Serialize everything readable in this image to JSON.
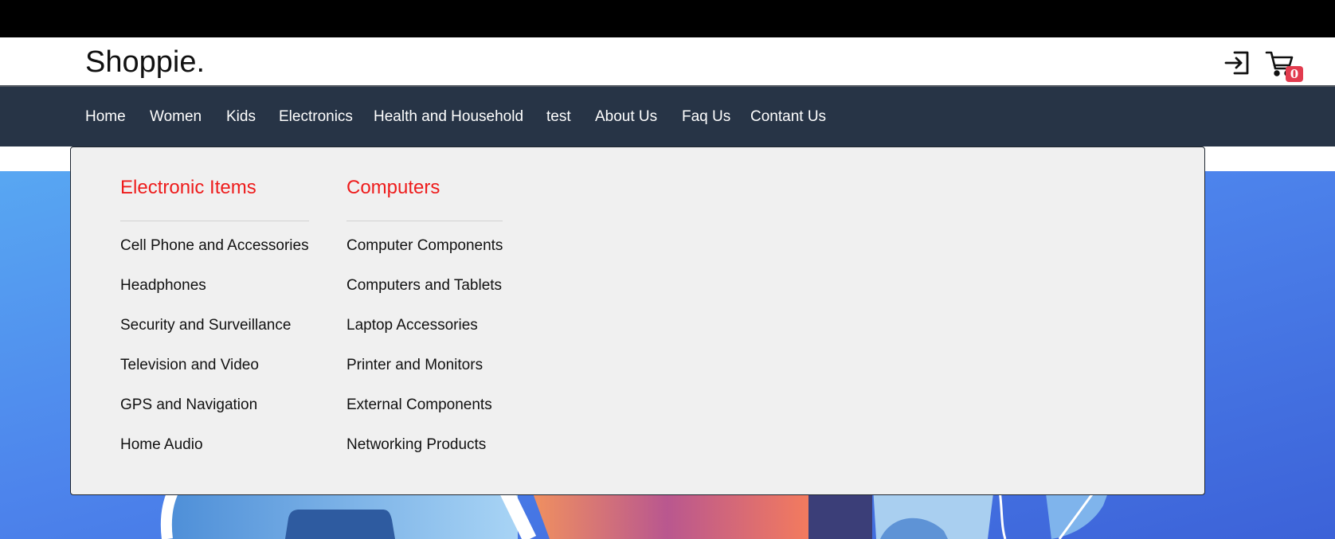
{
  "header": {
    "logo": "Shoppie.",
    "cart_count": "0"
  },
  "nav": {
    "items": [
      {
        "label": "Home"
      },
      {
        "label": "Women"
      },
      {
        "label": "Kids"
      },
      {
        "label": "Electronics"
      },
      {
        "label": "Health and Household"
      },
      {
        "label": "test"
      },
      {
        "label": "About Us"
      },
      {
        "label": "Faq Us"
      },
      {
        "label": "Contant Us"
      }
    ]
  },
  "mega_menu": {
    "columns": [
      {
        "title": "Electronic Items",
        "links": [
          "Cell Phone and Accessories",
          "Headphones",
          "Security and Surveillance",
          "Television and Video",
          "GPS and Navigation",
          "Home Audio"
        ]
      },
      {
        "title": "Computers",
        "links": [
          "Computer Components",
          "Computers and Tablets",
          "Laptop Accessories",
          "Printer and Monitors",
          "External Components",
          "Networking Products"
        ]
      }
    ]
  },
  "icons": {
    "login": "login-icon",
    "cart": "cart-icon"
  },
  "colors": {
    "navbar_bg": "#273446",
    "menu_title": "#ee1c1c",
    "badge": "#e23b4e",
    "dropdown_bg": "#f0f0f0"
  }
}
